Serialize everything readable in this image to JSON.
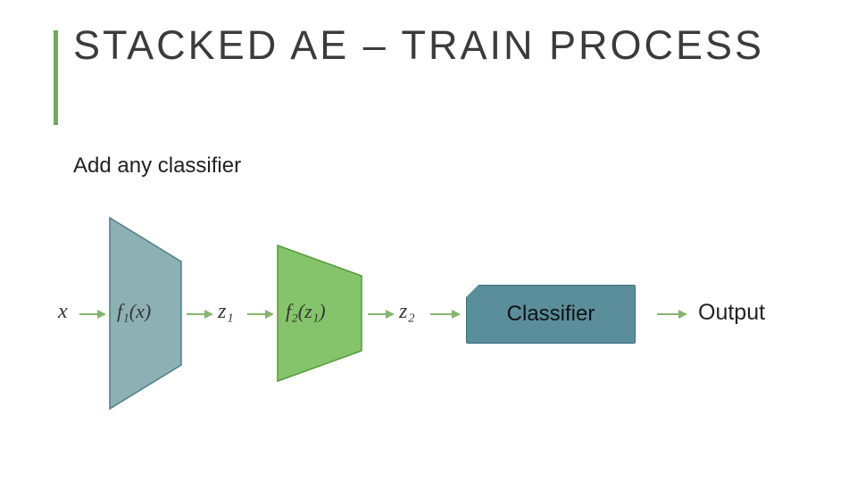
{
  "title": "STACKED AE – TRAIN PROCESS",
  "subtitle": "Add any classifier",
  "nodes": {
    "x": "x",
    "f1": "f₁(x)",
    "z1": "z₁",
    "f2": "f₂(z₁)",
    "z2": "z₂",
    "classifier": "Classifier",
    "output": "Output"
  },
  "colors": {
    "accent": "#72a75f",
    "trapezoid1_fill": "#8db0b4",
    "trapezoid1_stroke": "#4e7e84",
    "trapezoid2_fill": "#85c46a",
    "trapezoid2_stroke": "#569a3a",
    "classifier_fill": "#5a8e9b",
    "arrow": "#85b56e"
  }
}
